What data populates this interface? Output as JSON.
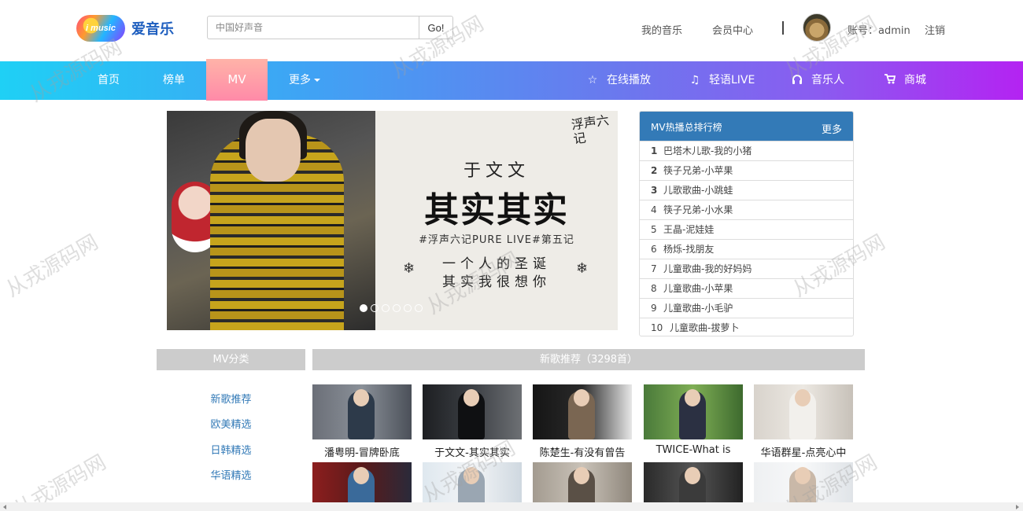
{
  "header": {
    "logo_text": "爱音乐",
    "logo_badge": "i music",
    "search_placeholder": "中国好声音",
    "search_button": "Go!",
    "my_music": "我的音乐",
    "member_center": "会员中心",
    "divider": "|",
    "account": "账号：admin",
    "logout": "注销"
  },
  "nav": {
    "home": "首页",
    "charts": "榜单",
    "mv": "MV",
    "more": "更多",
    "online_play": "在线播放",
    "light_live": "轻语LIVE",
    "musician": "音乐人",
    "mall": "商城",
    "icons": {
      "online_play": "star-icon",
      "light_live": "music-note-icon",
      "musician": "headphones-icon",
      "mall": "cart-icon"
    }
  },
  "banner": {
    "seal": "浮声六记",
    "artist": "于文文",
    "title": "其实其实",
    "subtitle": "#浮声六记PURE LIVE#第五记",
    "line1": "一个人的圣诞",
    "line2": "其实我很想你",
    "snowflake": "❄",
    "slide_count": 6,
    "active_slide": 1
  },
  "ranking": {
    "title": "MV热播总排行榜",
    "more": "更多",
    "items": [
      {
        "num": "1",
        "title": "巴塔木儿歌-我的小猪"
      },
      {
        "num": "2",
        "title": "筷子兄弟-小苹果"
      },
      {
        "num": "3",
        "title": "儿歌歌曲-小跳蛙"
      },
      {
        "num": "4",
        "title": "筷子兄弟-小水果"
      },
      {
        "num": "5",
        "title": "王晶-泥娃娃"
      },
      {
        "num": "6",
        "title": "杨烁-找朋友"
      },
      {
        "num": "7",
        "title": "儿童歌曲-我的好妈妈"
      },
      {
        "num": "8",
        "title": "儿童歌曲-小苹果"
      },
      {
        "num": "9",
        "title": "儿童歌曲-小毛驴"
      },
      {
        "num": "10",
        "title": "儿童歌曲-拔萝卜"
      }
    ]
  },
  "category": {
    "title": "MV分类",
    "items": [
      "新歌推荐",
      "欧美精选",
      "日韩精选",
      "华语精选"
    ]
  },
  "recommend": {
    "title": "新歌推荐（3298首）",
    "cards": [
      {
        "title": "潘粤明-冒牌卧底"
      },
      {
        "title": "于文文-其实其实"
      },
      {
        "title": "陈楚生-有没有曾告"
      },
      {
        "title": "TWICE-What is"
      },
      {
        "title": "华语群星-点亮心中"
      }
    ]
  },
  "watermark": "从戎源码网",
  "colors": {
    "nav_gradient_start": "#1fd0f5",
    "nav_gradient_end": "#b423f2",
    "mv_tab": "#ff8aa8",
    "rank_header": "#337ab7",
    "link": "#337ab7",
    "section_header": "#cccccc"
  }
}
